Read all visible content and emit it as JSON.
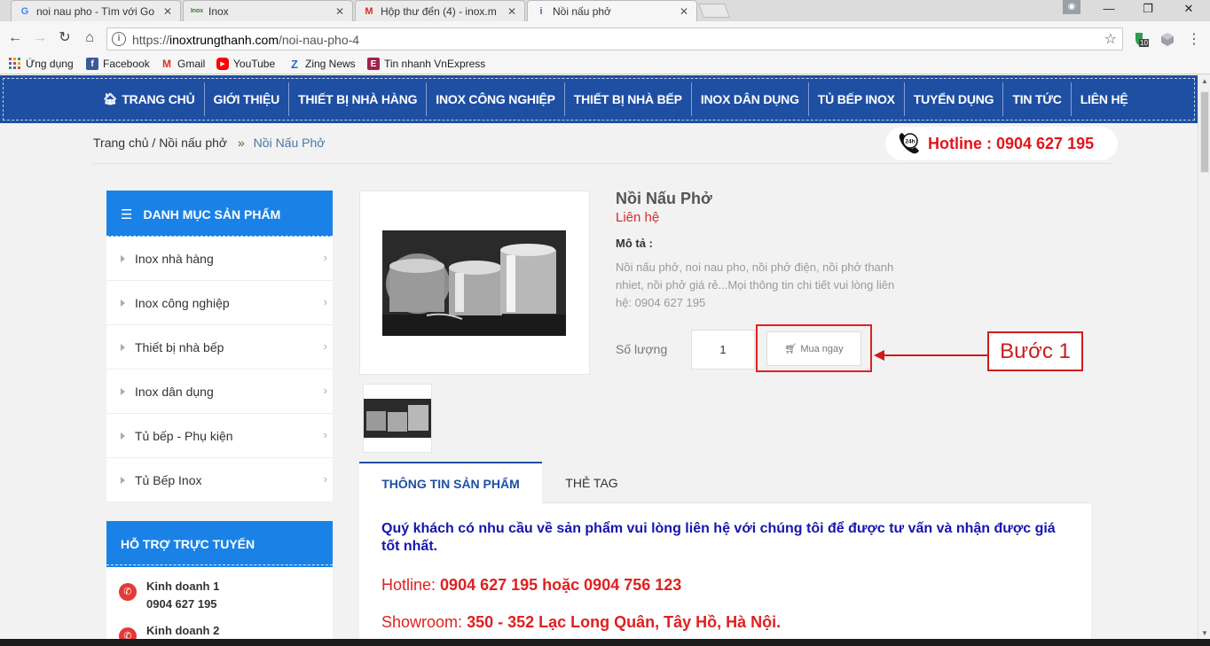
{
  "browser": {
    "tabs": [
      {
        "title": "noi nau pho - Tìm với Go",
        "favicon": "G",
        "close": "✕"
      },
      {
        "title": "Inox",
        "favicon": "Inox",
        "close": "✕"
      },
      {
        "title": "Hộp thư đến (4) - inox.m",
        "favicon": "M",
        "close": "✕"
      },
      {
        "title": "Nồi nấu phở",
        "favicon": "i",
        "close": "✕"
      }
    ],
    "url_prefix": "https://",
    "url_host": "inoxtrungthanh.com",
    "url_path": "/noi-nau-pho-4",
    "extension_badge": "10",
    "bookmarks": [
      {
        "label": "Ứng dụng",
        "color": "#e8a317",
        "icon": "apps-icon"
      },
      {
        "label": "Facebook",
        "color": "#3b5998",
        "icon": "facebook-icon"
      },
      {
        "label": "Gmail",
        "color": "#d93025",
        "icon": "gmail-icon"
      },
      {
        "label": "YouTube",
        "color": "#ff0000",
        "icon": "youtube-icon"
      },
      {
        "label": "Zing News",
        "color": "#3366cc",
        "icon": "zing-icon"
      },
      {
        "label": "Tin nhanh VnExpress",
        "color": "#9f224e",
        "icon": "vnexpress-icon"
      }
    ]
  },
  "nav": {
    "items": [
      "TRANG CHỦ",
      "GIỚI THIỆU",
      "THIẾT BỊ NHÀ HÀNG",
      "INOX CÔNG NGHIỆP",
      "THIẾT BỊ NHÀ BẾP",
      "INOX DÂN DỤNG",
      "TỦ BẾP INOX",
      "TUYỂN DỤNG",
      "TIN TỨC",
      "LIÊN HỆ"
    ]
  },
  "breadcrumb": {
    "home": "Trang chủ",
    "slash": "/",
    "category": "Nồi nấu phở",
    "sep": "»",
    "current": "Nồi Nấu Phở"
  },
  "hotline": {
    "badge": "24h",
    "text": "Hotline : 0904 627 195"
  },
  "sidebar": {
    "title": "DANH MỤC SẢN PHẨM",
    "items": [
      "Inox nhà hàng",
      "Inox công nghiệp",
      "Thiết bị nhà bếp",
      "Inox dân dụng",
      "Tủ bếp - Phụ kiện",
      "Tủ Bếp Inox"
    ],
    "support_title": "HỖ TRỢ TRỰC TUYẾN",
    "support": [
      {
        "name": "Kinh doanh 1",
        "phone": "0904 627 195"
      },
      {
        "name": "Kinh doanh 2",
        "phone": ""
      }
    ]
  },
  "product": {
    "title": "Nồi Nấu Phở",
    "price": "Liên hệ",
    "desc_label": "Mô tả :",
    "desc": "Nồi nấu phở, noi nau pho, nồi phở điện, nồi phở thanh nhiet, nồi phở giá rẻ...Mọi thông tin chi tiết vui lòng liên hệ: 0904 627 195",
    "qty_label": "Số lượng",
    "qty_value": "1",
    "buy_label": "Mua ngay"
  },
  "annotation": {
    "step": "Bước 1",
    "color": "#d01b1b"
  },
  "tabs": {
    "info": "THÔNG TIN SẢN PHẨM",
    "tag": "THẺ TAG"
  },
  "content": {
    "intro": "Quý khách có nhu cầu về sản phẩm vui lòng liên hệ với chúng tôi để được tư vấn và nhận được giá tốt nhất.",
    "hotline_label": "Hotline:",
    "hotline_value": "0904 627 195 hoặc 0904 756 123",
    "showroom_label": "Showroom:",
    "showroom_value": "350 - 352 Lạc Long Quân, Tây Hồ, Hà Nội."
  },
  "colors": {
    "nav_bg": "#1f4fa3",
    "side_head": "#1a82e6",
    "accent_red": "#e4141b"
  }
}
